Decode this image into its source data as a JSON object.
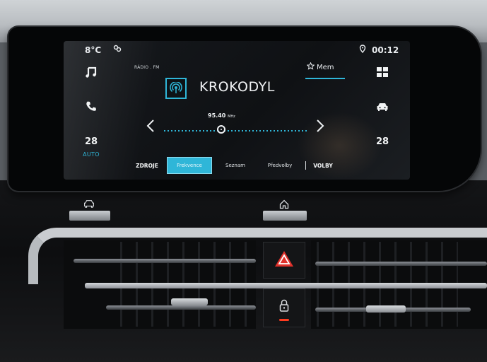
{
  "status_bar": {
    "temperature": "8°C",
    "time": "00:12",
    "icons": [
      "fan-icon",
      "location-pin-icon"
    ]
  },
  "left_panel": {
    "items": [
      {
        "icon": "music-note-icon"
      },
      {
        "icon": "phone-icon"
      },
      {
        "value": "28",
        "sub": "AUTO"
      }
    ]
  },
  "right_panel": {
    "items": [
      {
        "icon": "apps-grid-icon"
      },
      {
        "icon": "car-icon"
      },
      {
        "value": "28"
      }
    ]
  },
  "radio": {
    "source_label": "RÁDIO . FM",
    "mem_label": "Mem",
    "station": "KROKODYL",
    "frequency": "95.40",
    "frequency_unit": "MHz",
    "tuner_position": 0.4
  },
  "tabs": [
    {
      "label": "ZDROJE",
      "bold": true
    },
    {
      "label": "Frekvence",
      "active": true
    },
    {
      "label": "Seznam"
    },
    {
      "label": "Předvolby"
    },
    {
      "label": "VOLBY",
      "bold": true
    }
  ],
  "colors": {
    "accent": "#2fb6d8",
    "hazard": "#e0312b",
    "led": "#ff3b1f"
  }
}
